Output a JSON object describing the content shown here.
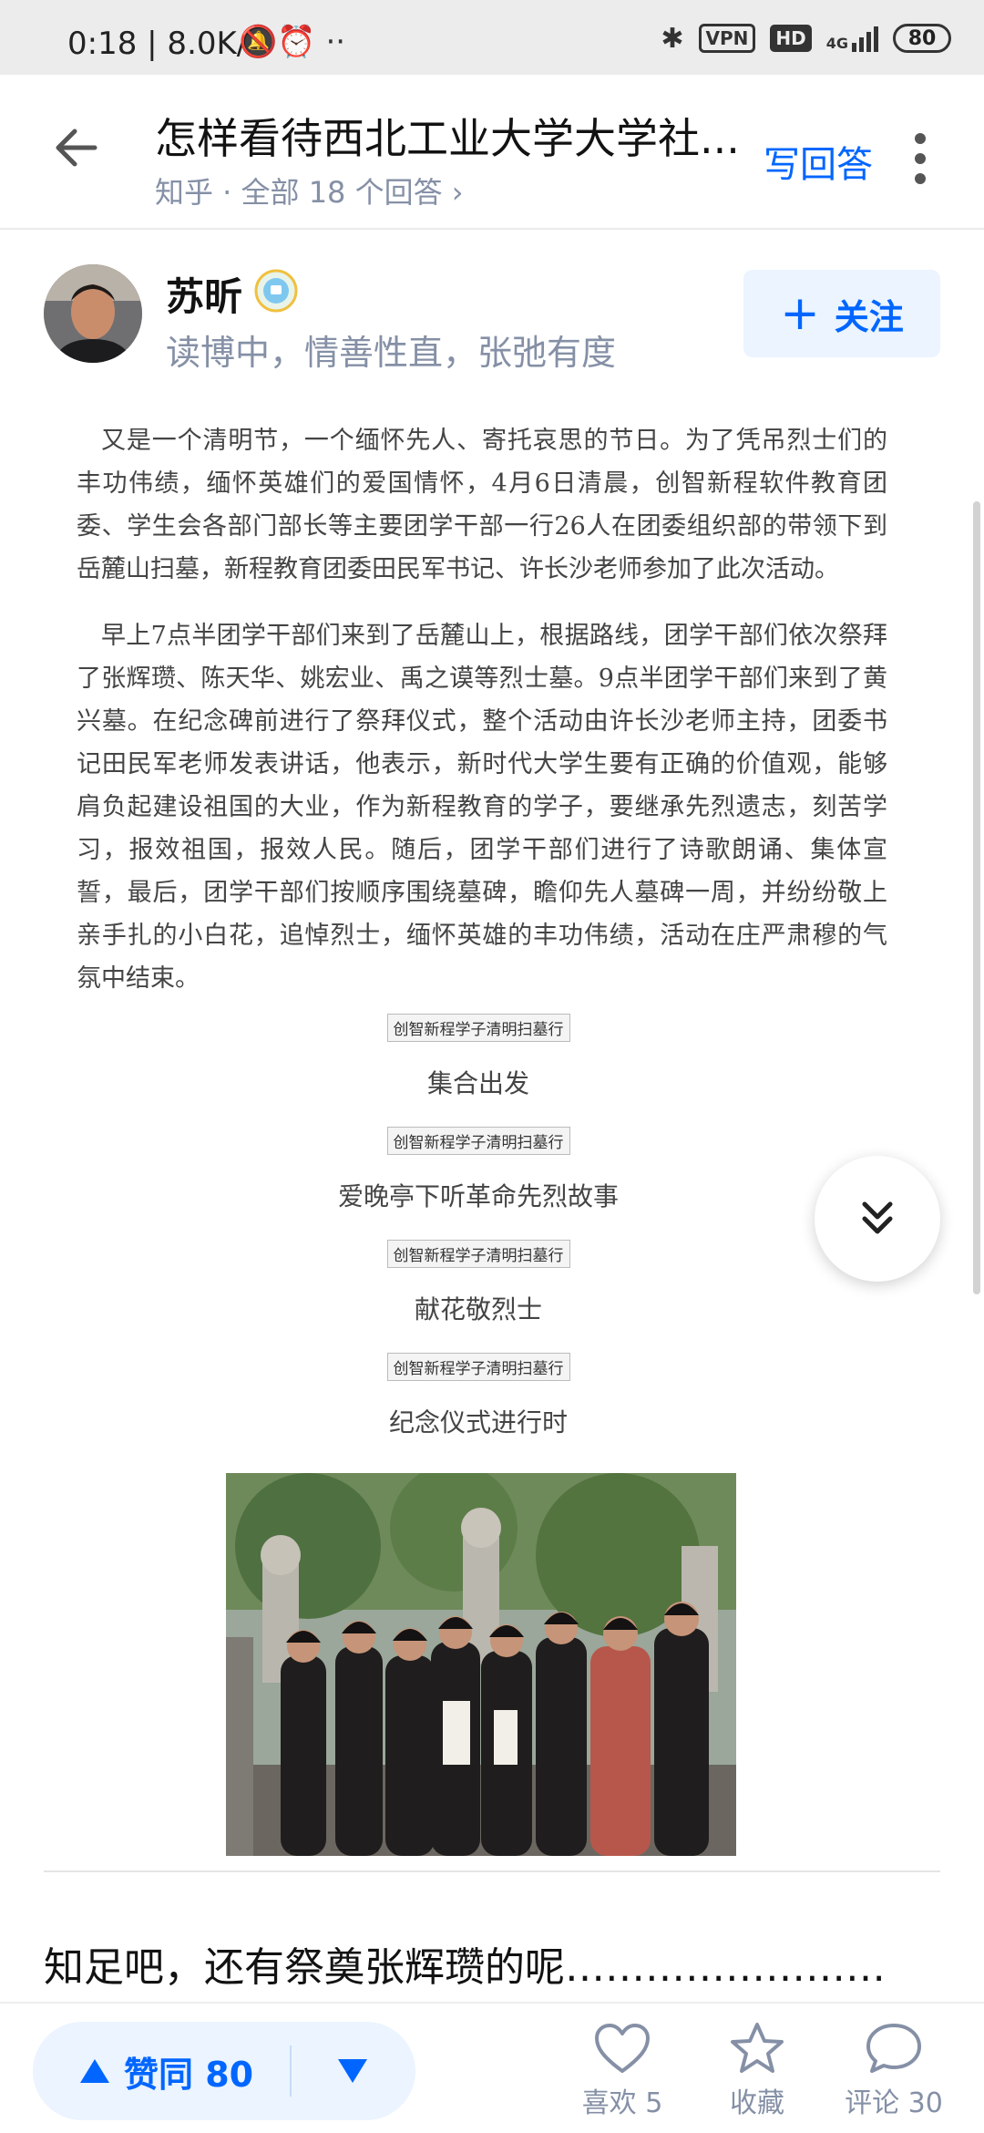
{
  "status_bar": {
    "time": "0:18",
    "speed": "| 8.0K/s",
    "icons": [
      "bell-off-icon",
      "alarm-icon",
      "more-dots-icon",
      "bluetooth-icon",
      "vpn-icon",
      "hd-icon",
      "signal-4g-icon",
      "battery-icon"
    ],
    "vpn_label": "VPN",
    "hd_label": "HD",
    "network_label": "4G",
    "battery": "80"
  },
  "header": {
    "title": "怎样看待西北工业大学大学社...",
    "subtitle": "知乎 · 全部 18 个回答 ›",
    "write_answer": "写回答"
  },
  "author": {
    "name": "苏昕",
    "bio": "读博中，情善性直，张弛有度",
    "follow_label": "关注"
  },
  "article": {
    "paragraphs": [
      "又是一个清明节，一个缅怀先人、寄托哀思的节日。为了凭吊烈士们的丰功伟绩，缅怀英雄们的爱国情怀，4月6日清晨，创智新程软件教育团委、学生会各部门部长等主要团学干部一行26人在团委组织部的带领下到岳麓山扫墓，新程教育团委田民军书记、许长沙老师参加了此次活动。",
      "早上7点半团学干部们来到了岳麓山上，根据路线，团学干部们依次祭拜了张辉瓒、陈天华、姚宏业、禹之谟等烈士墓。9点半团学干部们来到了黄兴墓。在纪念碑前进行了祭拜仪式，整个活动由许长沙老师主持，团委书记田民军老师发表讲话，他表示，新时代大学生要有正确的价值观，能够肩负起建设祖国的大业，作为新程教育的学子，要继承先烈遗志，刻苦学习，报效祖国，报效人民。随后，团学干部们进行了诗歌朗诵、集体宣誓，最后，团学干部们按顺序围绕墓碑，瞻仰先人墓碑一周，并纷纷敬上亲手扎的小白花，追悼烈士，缅怀英雄的丰功伟绩，活动在庄严肃穆的气氛中结束。"
    ],
    "image_label": "创智新程学子清明扫墓行",
    "captions": [
      "集合出发",
      "爱晚亭下听革命先烈故事",
      "献花敬烈士",
      "纪念仪式进行时"
    ]
  },
  "next_answer": {
    "preview": "知足吧，还有祭奠张辉瓒的呢……………………"
  },
  "bottom_bar": {
    "upvote_label": "赞同 80",
    "like_label": "喜欢 5",
    "collect_label": "收藏",
    "comment_label": "评论 30"
  },
  "colors": {
    "brand_blue": "#0066ff",
    "muted_gray": "#8590a6",
    "pill_bg": "#ebf4ff"
  }
}
